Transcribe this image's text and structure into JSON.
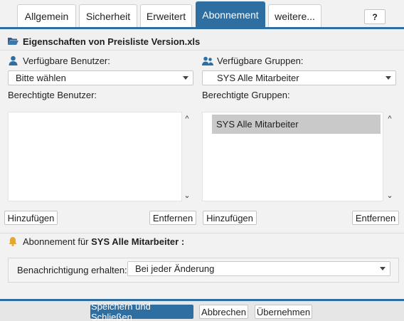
{
  "tabs": [
    {
      "label": "Allgemein"
    },
    {
      "label": "Sicherheit"
    },
    {
      "label": "Erweitert"
    },
    {
      "label": "Abonnement"
    },
    {
      "label": "weitere..."
    }
  ],
  "help_label": "?",
  "header": {
    "title": "Eigenschaften von Preisliste Version.xls"
  },
  "users": {
    "available_label": "Verfügbare Benutzer:",
    "select_value": "Bitte wählen",
    "authorized_label": "Berechtigte Benutzer:",
    "items": [],
    "add_label": "Hinzufügen",
    "remove_label": "Entfernen"
  },
  "groups": {
    "available_label": "Verfügbare Gruppen:",
    "select_value": "SYS Alle Mitarbeiter",
    "authorized_label": "Berechtigte Gruppen:",
    "items": [
      {
        "label": "SYS Alle Mitarbeiter"
      }
    ],
    "add_label": "Hinzufügen",
    "remove_label": "Entfernen"
  },
  "subscription": {
    "title_prefix": "Abonnement für",
    "title_group": "SYS Alle Mitarbeiter",
    "title_suffix": ":",
    "notify_label": "Benachrichtigung erhalten:",
    "notify_value": "Bei jeder Änderung"
  },
  "footer": {
    "save_close": "Speichern und Schließen",
    "cancel": "Abbrechen",
    "apply": "Übernehmen"
  },
  "colors": {
    "accent": "#2e6ea1",
    "selection": "#c9c9c9",
    "bell": "#e3a72f"
  }
}
